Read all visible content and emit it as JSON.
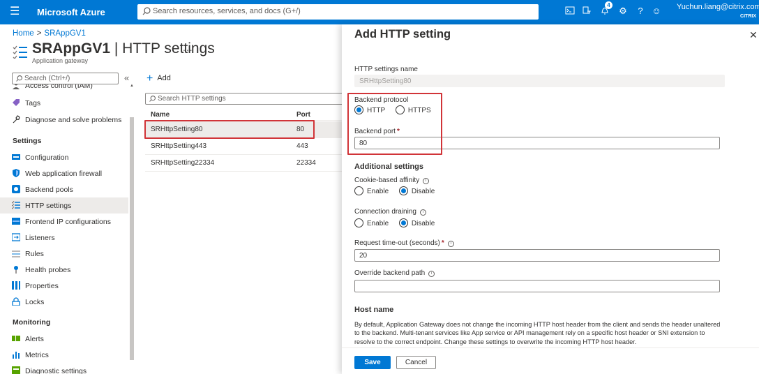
{
  "topbar": {
    "brand": "Microsoft Azure",
    "search_placeholder": "Search resources, services, and docs (G+/)",
    "notification_count": "4",
    "user_email": "Yuchun.liang@citrix.com",
    "tenant": "CITRIX"
  },
  "breadcrumb": {
    "home": "Home",
    "separator": ">",
    "resource": "SRAppGV1"
  },
  "page": {
    "title_resource": "SRAppGV1",
    "title_section": "HTTP settings",
    "title_divider": " | ",
    "more": "...",
    "subtitle": "Application gateway"
  },
  "nav": {
    "search_placeholder": "Search (Ctrl+/)",
    "collapse": "«",
    "items_top": [
      {
        "label": "Access control (IAM)",
        "icon": "people-icon"
      },
      {
        "label": "Tags",
        "icon": "tag-icon"
      },
      {
        "label": "Diagnose and solve problems",
        "icon": "wrench-icon"
      }
    ],
    "settings_header": "Settings",
    "settings_items": [
      {
        "label": "Configuration",
        "icon": "config-icon"
      },
      {
        "label": "Web application firewall",
        "icon": "shield-icon"
      },
      {
        "label": "Backend pools",
        "icon": "backend-pool-icon"
      },
      {
        "label": "HTTP settings",
        "icon": "http-settings-icon"
      },
      {
        "label": "Frontend IP configurations",
        "icon": "frontend-ip-icon"
      },
      {
        "label": "Listeners",
        "icon": "listener-icon"
      },
      {
        "label": "Rules",
        "icon": "rules-icon"
      },
      {
        "label": "Health probes",
        "icon": "health-probe-icon"
      },
      {
        "label": "Properties",
        "icon": "properties-icon"
      },
      {
        "label": "Locks",
        "icon": "lock-icon"
      }
    ],
    "monitoring_header": "Monitoring",
    "monitoring_items": [
      {
        "label": "Alerts",
        "icon": "alerts-icon"
      },
      {
        "label": "Metrics",
        "icon": "metrics-icon"
      },
      {
        "label": "Diagnostic settings",
        "icon": "diagnostic-icon"
      }
    ]
  },
  "list": {
    "add_label": "Add",
    "search_placeholder": "Search HTTP settings",
    "columns": [
      "Name",
      "Port"
    ],
    "rows": [
      {
        "name": "SRHttpSetting80",
        "port": "80"
      },
      {
        "name": "SRHttpSetting443",
        "port": "443"
      },
      {
        "name": "SRHttpSetting22334",
        "port": "22334"
      }
    ]
  },
  "blade": {
    "title": "Add HTTP setting",
    "name_label": "HTTP settings name",
    "name_value": "SRHttpSetting80",
    "protocol_label": "Backend protocol",
    "protocol_options": [
      "HTTP",
      "HTTPS"
    ],
    "protocol_selected": "HTTP",
    "port_label": "Backend port",
    "port_value": "80",
    "required_marker": "*",
    "additional_header": "Additional settings",
    "affinity_label": "Cookie-based affinity",
    "affinity_options": [
      "Enable",
      "Disable"
    ],
    "affinity_selected": "Disable",
    "draining_label": "Connection draining",
    "draining_options": [
      "Enable",
      "Disable"
    ],
    "draining_selected": "Disable",
    "timeout_label": "Request time-out (seconds)",
    "timeout_value": "20",
    "override_label": "Override backend path",
    "override_value": "",
    "hostname_header": "Host name",
    "hostname_desc": "By default, Application Gateway does not change the incoming HTTP host header from the client and sends the header unaltered to the backend. Multi-tenant services like App service or API management rely on a specific host header or SNI extension to resolve to the correct endpoint. Change these settings to overwrite the incoming HTTP host header.",
    "save_label": "Save",
    "cancel_label": "Cancel"
  },
  "colors": {
    "accent": "#0078d4",
    "highlight": "#d13438",
    "required": "#a4262c"
  }
}
